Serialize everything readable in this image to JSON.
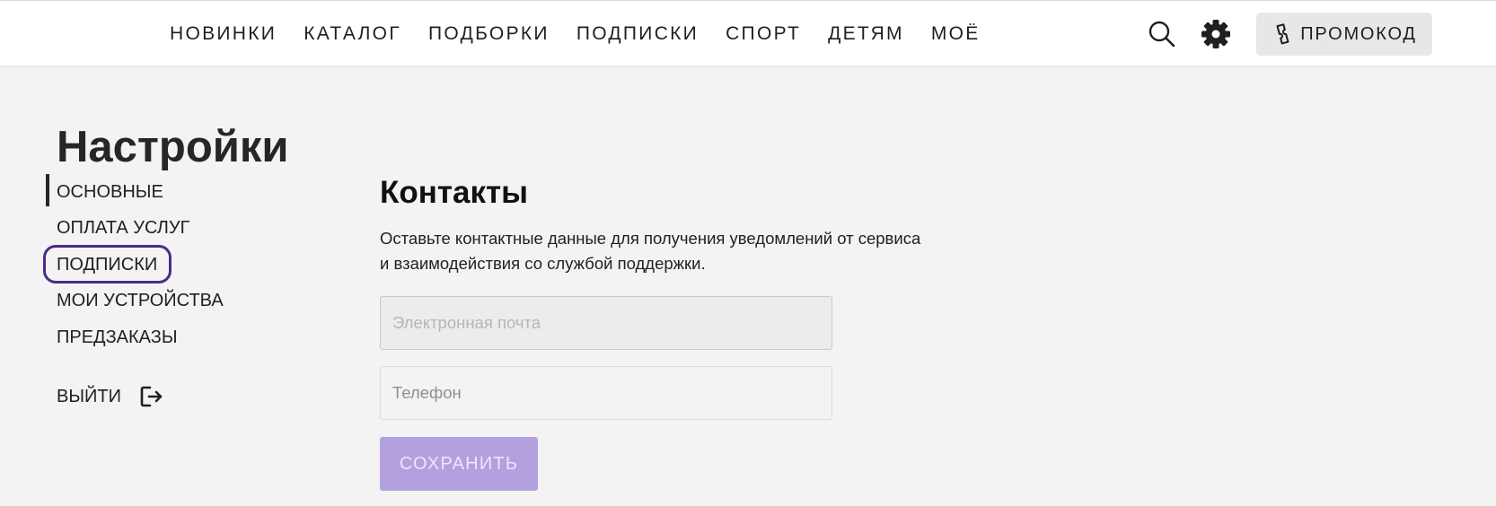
{
  "header": {
    "nav": [
      {
        "label": "НОВИНКИ"
      },
      {
        "label": "КАТАЛОГ"
      },
      {
        "label": "ПОДБОРКИ"
      },
      {
        "label": "ПОДПИСКИ"
      },
      {
        "label": "СПОРТ"
      },
      {
        "label": "ДЕТЯМ"
      },
      {
        "label": "МОЁ"
      }
    ],
    "icons": {
      "search": "search-icon",
      "settings": "gear-icon",
      "promo": "ticket-icon"
    },
    "promo_label": "ПРОМОКОД"
  },
  "sidebar": {
    "title": "Настройки",
    "items": [
      {
        "label": "ОСНОВНЫЕ",
        "active": true
      },
      {
        "label": "ОПЛАТА УСЛУГ"
      },
      {
        "label": "ПОДПИСКИ",
        "focused": true
      },
      {
        "label": "МОИ УСТРОЙСТВА"
      },
      {
        "label": "ПРЕДЗАКАЗЫ"
      }
    ],
    "logout_label": "ВЫЙТИ",
    "logout_icon": "logout-icon"
  },
  "main": {
    "title": "Контакты",
    "description_line1": "Оставьте контактные данные для получения уведомлений от сервиса",
    "description_line2": "и взаимодействия со службой поддержки.",
    "email": {
      "value": "",
      "placeholder": "Электронная почта"
    },
    "phone": {
      "value": "",
      "placeholder": "Телефон"
    },
    "save_label": "СОХРАНИТЬ"
  },
  "colors": {
    "accent": "#b3a0df",
    "focus_ring": "#4b2a8c",
    "background": "#f3f3f3"
  }
}
